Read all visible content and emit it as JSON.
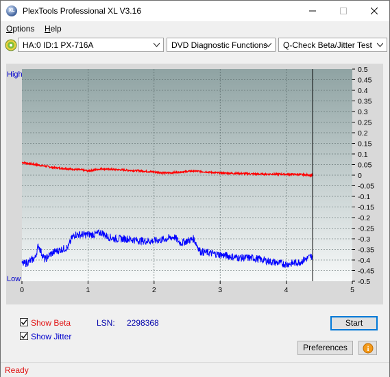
{
  "window": {
    "title": "PlexTools Professional XL V3.16",
    "icon_text": "XL"
  },
  "menu": [
    {
      "label": "Options",
      "accel": "O",
      "rest": "ptions"
    },
    {
      "label": "Help",
      "accel": "H",
      "rest": "elp"
    }
  ],
  "toolbar": {
    "drive": "HA:0 ID:1  PX-716A",
    "function": "DVD Diagnostic Functions",
    "test": "Q-Check Beta/Jitter Test"
  },
  "chart_data": {
    "type": "line",
    "y_top_label": "High",
    "y_bottom_label": "Low",
    "x_ticks": [
      "0",
      "1",
      "2",
      "3",
      "4",
      "5"
    ],
    "xlim": [
      0,
      5
    ],
    "y_right_ticks": [
      "0.5",
      "0.45",
      "0.4",
      "0.35",
      "0.3",
      "0.25",
      "0.2",
      "0.15",
      "0.1",
      "0.05",
      "0",
      "-0.05",
      "-0.1",
      "-0.15",
      "-0.2",
      "-0.25",
      "-0.3",
      "-0.35",
      "-0.4",
      "-0.45",
      "-0.5"
    ],
    "ylim": [
      -0.5,
      0.5
    ],
    "cursor_x": 4.4,
    "grid": true,
    "series": [
      {
        "color": "#ff0000",
        "x": [
          0,
          0.1,
          0.3,
          0.5,
          0.7,
          0.9,
          1.0,
          1.2,
          1.5,
          1.8,
          2.0,
          2.2,
          2.4,
          2.6,
          2.8,
          3.0,
          3.3,
          3.6,
          3.9,
          4.2,
          4.4
        ],
        "y": [
          0.06,
          0.055,
          0.045,
          0.035,
          0.03,
          0.025,
          0.02,
          0.03,
          0.025,
          0.02,
          0.015,
          0.01,
          0.015,
          0.02,
          0.015,
          0.01,
          0.008,
          0.005,
          0.005,
          0.003,
          0.0
        ]
      },
      {
        "color": "#0000ff",
        "x": [
          0,
          0.1,
          0.2,
          0.25,
          0.3,
          0.35,
          0.4,
          0.5,
          0.6,
          0.7,
          0.75,
          0.8,
          1.0,
          1.1,
          1.2,
          1.3,
          1.4,
          1.6,
          1.8,
          2.0,
          2.2,
          2.3,
          2.4,
          2.6,
          2.65,
          2.7,
          2.9,
          3.1,
          3.3,
          3.5,
          3.8,
          4.0,
          4.2,
          4.4
        ],
        "y": [
          -0.42,
          -0.41,
          -0.39,
          -0.33,
          -0.37,
          -0.4,
          -0.38,
          -0.36,
          -0.35,
          -0.34,
          -0.3,
          -0.28,
          -0.28,
          -0.28,
          -0.27,
          -0.29,
          -0.3,
          -0.3,
          -0.31,
          -0.31,
          -0.3,
          -0.29,
          -0.32,
          -0.3,
          -0.33,
          -0.36,
          -0.37,
          -0.38,
          -0.39,
          -0.39,
          -0.41,
          -0.42,
          -0.41,
          -0.38
        ]
      }
    ]
  },
  "options": {
    "show_beta_label": "Show Beta",
    "show_beta_accel": "B",
    "show_jitter_label": "Show Jitter",
    "show_jitter_accel": "J",
    "lsn_label": "LSN:",
    "lsn_value": "2298368"
  },
  "buttons": {
    "start": "Start",
    "preferences": "Preferences"
  },
  "status": {
    "text": "Ready"
  }
}
